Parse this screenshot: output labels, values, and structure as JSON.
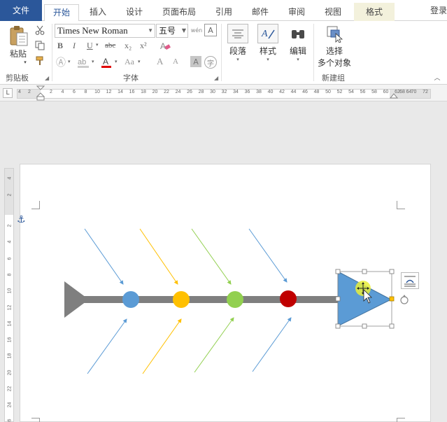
{
  "tabs": {
    "file": "文件",
    "home": "开始",
    "insert": "插入",
    "design": "设计",
    "layout": "页面布局",
    "references": "引用",
    "mailings": "邮件",
    "review": "审阅",
    "view": "视图",
    "format": "格式",
    "login": "登录"
  },
  "clipboard": {
    "paste": "粘贴",
    "group": "剪贴板"
  },
  "font": {
    "name": "Times New Roman",
    "size": "五号",
    "group": "字体",
    "bold": "B",
    "italic": "I",
    "underline": "U",
    "strike": "abc",
    "sub": "x₂",
    "sup": "x²",
    "case": "Aa",
    "grow": "A",
    "shrink": "A"
  },
  "paragraph": {
    "label": "段落"
  },
  "styles": {
    "label": "样式"
  },
  "editing": {
    "label": "编辑"
  },
  "select": {
    "line1": "选择",
    "line2": "多个对象",
    "group": "新建组"
  },
  "ruler": {
    "ticks": [
      "4",
      "2",
      "2",
      "4",
      "6",
      "8",
      "10",
      "12",
      "14",
      "16",
      "18",
      "20",
      "22",
      "24",
      "26",
      "28",
      "30",
      "32",
      "34",
      "36",
      "38",
      "40",
      "42",
      "44",
      "46",
      "48",
      "50",
      "52",
      "54",
      "56",
      "58",
      "60",
      "62",
      "64",
      "68",
      "70",
      "72"
    ],
    "vticks": [
      "4",
      "2",
      "2",
      "4",
      "6",
      "8",
      "10",
      "12",
      "14",
      "16",
      "18",
      "20",
      "22",
      "24",
      "26",
      "28"
    ]
  },
  "diagram": {
    "node_colors": [
      "#5b9bd5",
      "#ffc000",
      "#92d050",
      "#c00000"
    ],
    "spine_color": "#7f7f7f",
    "head_color": "#5b9bd5"
  }
}
